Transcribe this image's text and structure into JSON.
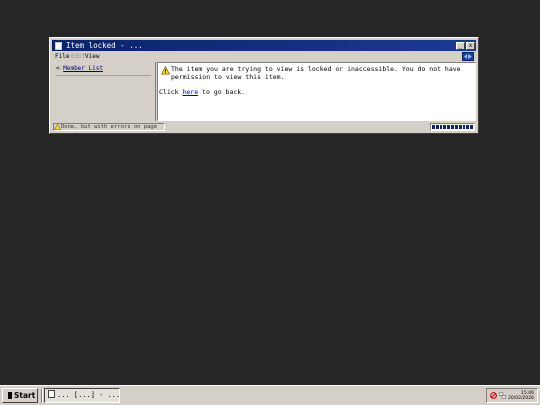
{
  "window": {
    "title": "Item locked - ...",
    "minimize_glyph": "_",
    "close_glyph": "x"
  },
  "menu": {
    "file": "File",
    "edit": "Edit",
    "view": "View"
  },
  "sidebar": {
    "back_arrow": "< ",
    "member_list": "Member List"
  },
  "content": {
    "message": "The item you are trying to view is locked or inaccessible. You do not have permission to view this item.",
    "back_prefix": "Click ",
    "back_link": "here",
    "back_suffix": " to go back."
  },
  "status": {
    "text": "Done, but with errors on page",
    "progress": 1.0
  },
  "taskbar": {
    "start_label": "Start",
    "task_label": "... [...] - ...",
    "time": "15:06",
    "date": "20/02/2026"
  },
  "colors": {
    "desktop": "#262626",
    "titlebar": "#0a246a",
    "chrome": "#d4d0c8",
    "link": "#0000cc"
  },
  "icons": {
    "window": "page-icon",
    "warning": "warning-triangle-icon",
    "status": "error-warning-icon",
    "tray_1": "no-entry-icon",
    "tray_2": "network-icon"
  }
}
